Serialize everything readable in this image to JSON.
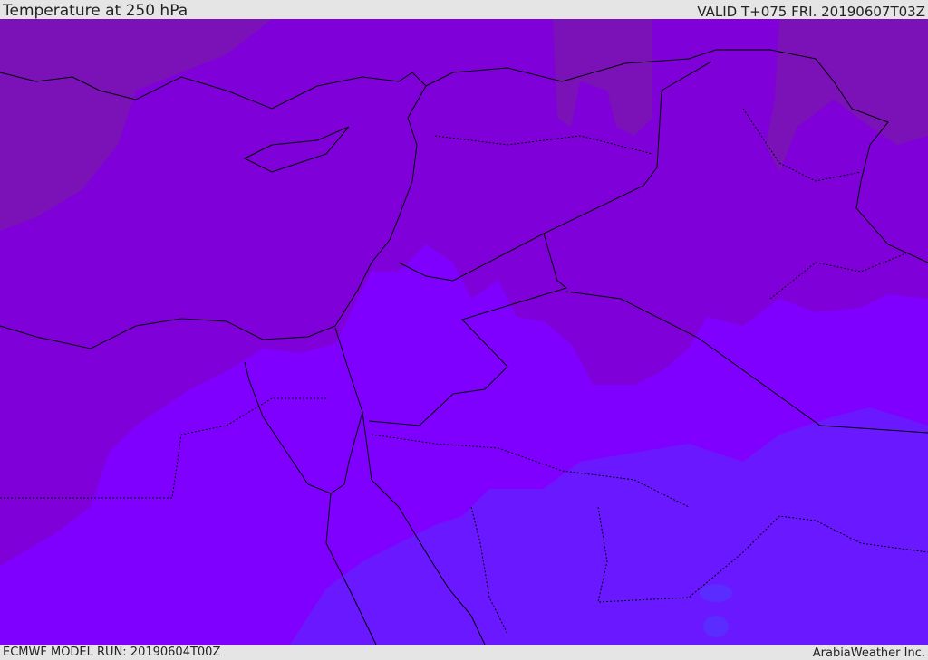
{
  "header": {
    "title": "Temperature at 250 hPa",
    "valid": "VALID T+075 FRI. 20190607T03Z"
  },
  "footer": {
    "model_run": "ECMWF MODEL RUN: 20190604T00Z",
    "credit": "ArabiaWeather Inc."
  },
  "map": {
    "variable": "Temperature",
    "level": "250 hPa",
    "colors": {
      "coldest_band": "#7a12b8",
      "cold_band": "#7f00d8",
      "mid_band": "#8000ff",
      "warm_band": "#6a18ff",
      "warmest_band": "#5a2cff",
      "borders": "#000000"
    }
  }
}
